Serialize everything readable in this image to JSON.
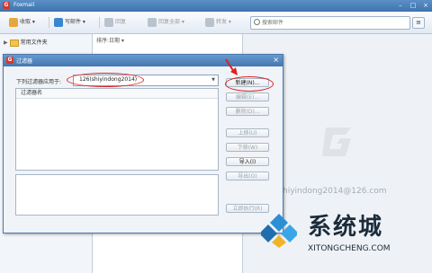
{
  "window": {
    "title": "Foxmail",
    "app_icon_letter": "G"
  },
  "toolbar": {
    "receive": "收取",
    "compose": "写邮件",
    "reply": "回复",
    "reply_all": "回复全部",
    "forward": "转发",
    "search_placeholder": "搜索邮件",
    "menu_icon": "≡"
  },
  "sidebar": {
    "folder_label": "常用文件夹",
    "expand_arrow": "▶"
  },
  "maillist": {
    "sort_label": "排序:日期 ▾"
  },
  "reader": {
    "email_watermark": "hiyindong2014@126.com"
  },
  "dialog": {
    "title": "过滤器",
    "close_glyph": "×",
    "apply_label": "下列过滤器应用于:",
    "account_value": "126(shiyindong2014)",
    "column_header": "过滤器名",
    "buttons": {
      "new": "新建(N)...",
      "edit": "编辑(E)...",
      "delete": "删除(D)...",
      "move_up": "上移(U)",
      "move_down": "下移(W)",
      "import": "导入(I)",
      "export": "导出(O)",
      "run_now": "立即执行(R)"
    }
  },
  "watermark": {
    "name": "系统城",
    "url": "XITONGCHENG.COM"
  },
  "colors": {
    "annotation": "#e02020",
    "title_bar": "#4477b0",
    "watermark_blue": "#2b8fd6"
  }
}
